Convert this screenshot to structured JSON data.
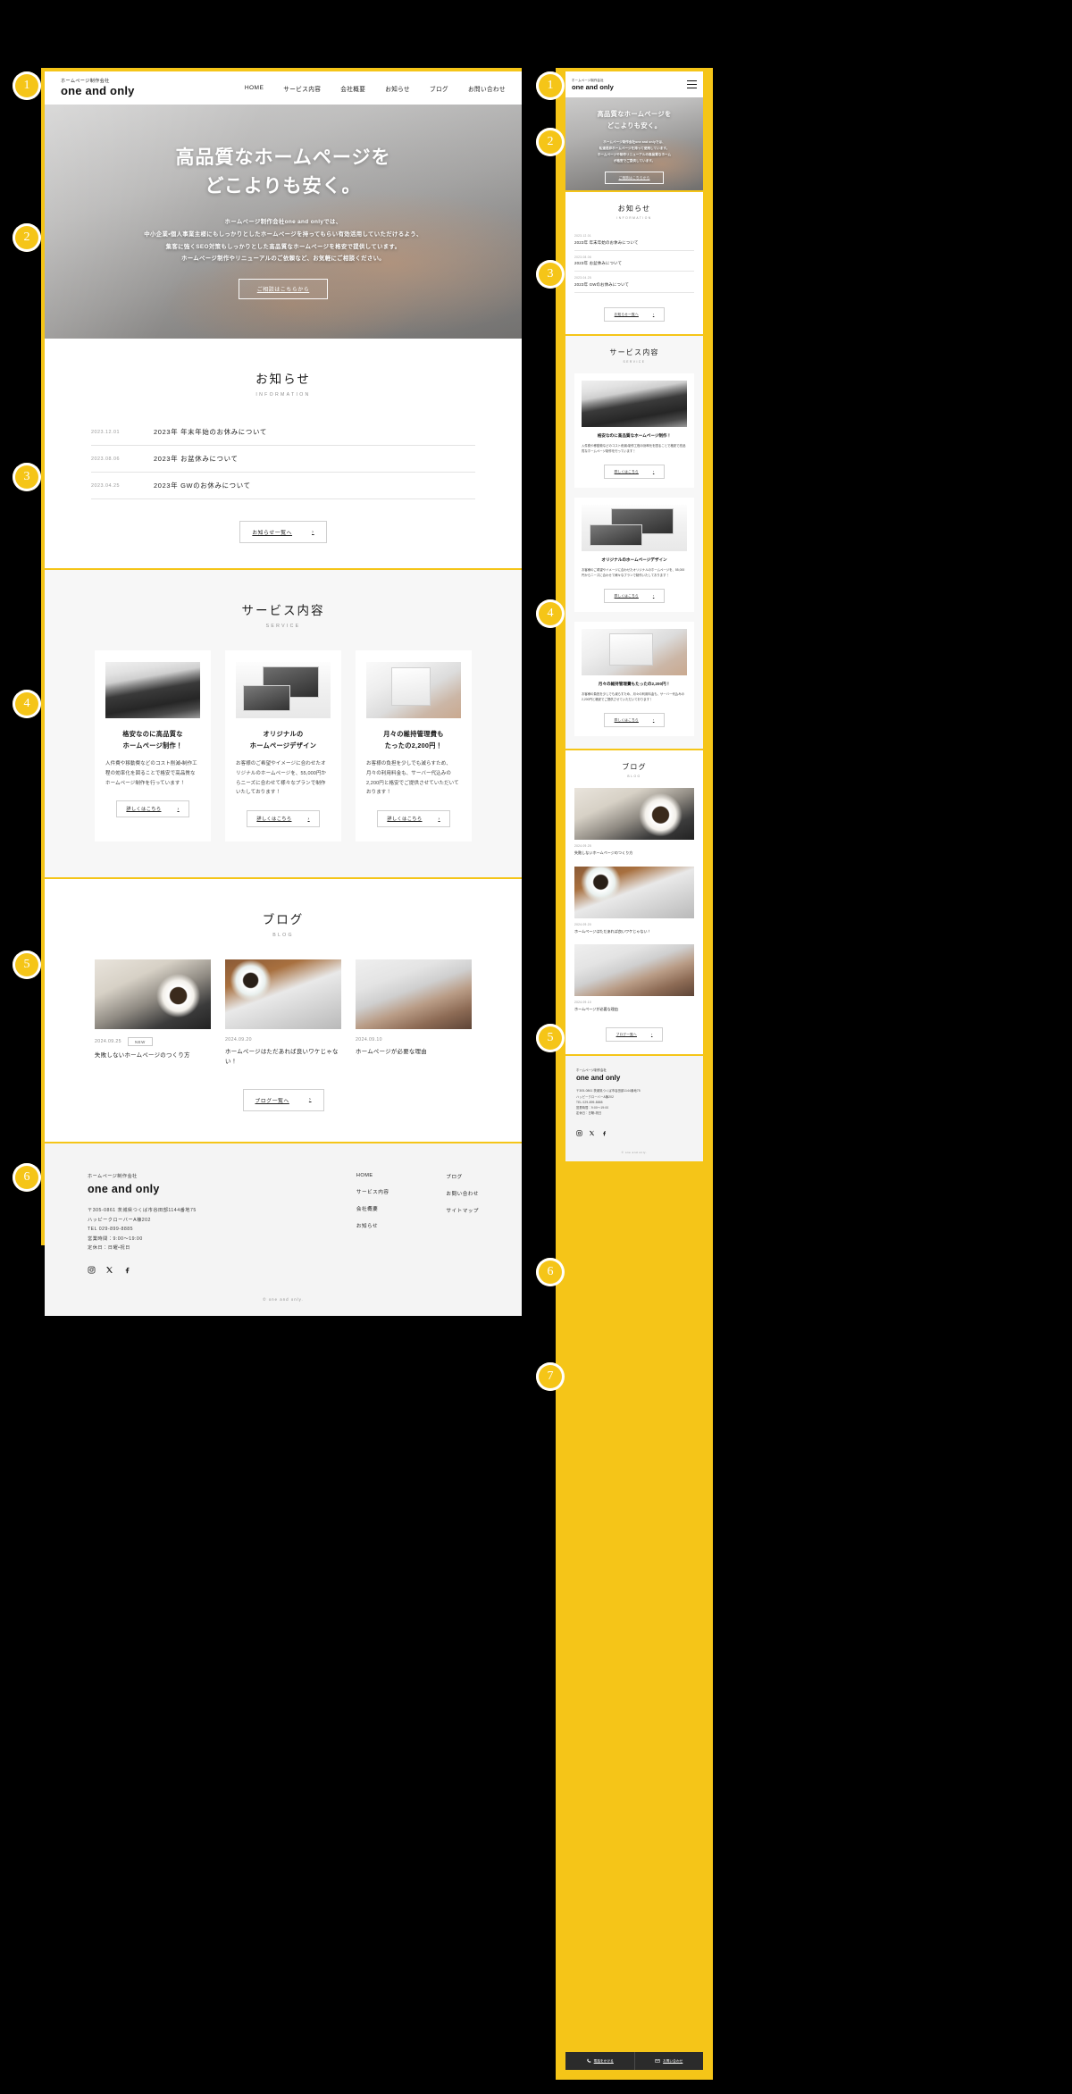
{
  "brand": {
    "sub": "ホームページ制作会社",
    "name": "one and only"
  },
  "nav": {
    "items": [
      "HOME",
      "サービス内容",
      "会社概要",
      "お知らせ",
      "ブログ",
      "お問い合わせ"
    ]
  },
  "hero": {
    "title_line1": "高品質なホームページを",
    "title_line2": "どこよりも安く。",
    "desc": [
      "ホームページ制作会社one and onlyでは、",
      "中小企業・個人事業主様にもしっかりとしたホームページを持ってもらい有効活用していただけるよう、",
      "集客に強くSEO対策もしっかりとした高品質なホームページを格安で提供しています。",
      "ホームページ制作やリニューアルのご依頼など、お気軽にご相談ください。"
    ],
    "mobile_desc": [
      "ホームページ制作会社one and onlyでは、",
      "私達是非ホームページを持って使用しています。",
      "ホームページや制作リニューアルの高品質なホーム",
      "が格安でご提供しています。"
    ],
    "cta": "ご相談はこちらから"
  },
  "news": {
    "heading_ja": "お知らせ",
    "heading_en": "INFORMATION",
    "items": [
      {
        "date": "2023.12.01",
        "title": "2023年 年末年始のお休みについて"
      },
      {
        "date": "2023.08.06",
        "title": "2023年 お盆休みについて"
      },
      {
        "date": "2023.04.25",
        "title": "2023年 GWのお休みについて"
      }
    ],
    "more": "お知らせ一覧へ"
  },
  "service": {
    "heading_ja": "サービス内容",
    "heading_en": "SERVICE",
    "cards": [
      {
        "image": "laptop-keyboard-photo",
        "title_line1": "格安なのに高品質な",
        "title_line2": "ホームページ制作！",
        "body": "人件費や移動費などのコスト削減・制作工程の効率化を図ることで格安で高品質なホームページ制作を行っています！",
        "button": "詳しくはこちら"
      },
      {
        "image": "responsive-devices-photo",
        "title_line1": "オリジナルの",
        "title_line2": "ホームページデザイン",
        "body": "お客様のご希望やイメージに合わせたオリジナルのホームページを、55,000円からニーズに合わせて様々なプランで制作いたしております！",
        "button": "詳しくはこちら"
      },
      {
        "image": "calculator-hand-photo",
        "title_line1": "月々の維持管理費も",
        "title_line2": "たったの2,200円！",
        "body": "お客様の負担を少しでも減らすため、月々の利用料金も、サーバー代込みの2,200円と格安でご提供させていただいております！",
        "button": "詳しくはこちら"
      }
    ]
  },
  "blog": {
    "heading_ja": "ブログ",
    "heading_en": "BLOG",
    "posts": [
      {
        "image": "laptop-coffee-photo",
        "date": "2024.09.25",
        "badge": "NEW",
        "title": "失敗しないホームページのつくり方"
      },
      {
        "image": "coffee-keyboard-photo",
        "date": "2024.09.20",
        "badge": "",
        "title": "ホームページはただあれば良いワケじゃない！"
      },
      {
        "image": "woman-laptop-photo",
        "date": "2024.09.10",
        "badge": "",
        "title": "ホームページが必要な理由"
      }
    ],
    "more": "ブログ一覧へ"
  },
  "footer": {
    "sub": "ホームページ制作会社",
    "name": "one and only",
    "address_lines": [
      "〒305-0861 茨城県つくば市谷田部1144番地75",
      "ハッピークローバーA棟202",
      "TEL 029-899-8885",
      "営業時間：9:00〜19:00",
      "定休日：日曜・祝日"
    ],
    "nav_col1": [
      "HOME",
      "サービス内容",
      "会社概要",
      "お知らせ"
    ],
    "nav_col2": [
      "ブログ",
      "お問い合わせ",
      "サイトマップ"
    ],
    "socials": [
      "instagram-icon",
      "x-twitter-icon",
      "facebook-icon"
    ],
    "copyright": "© one and only."
  },
  "mobile_bottom_bar": {
    "call": "電話をかける",
    "contact": "お問い合わせ",
    "call_icon": "phone-icon",
    "contact_icon": "mail-icon"
  },
  "callouts": {
    "desktop": [
      "1",
      "2",
      "3",
      "4",
      "5",
      "6"
    ],
    "mobile": [
      "1",
      "2",
      "3",
      "4",
      "5",
      "6",
      "7"
    ]
  },
  "colors": {
    "accent": "#F5C518",
    "text": "#1b1b1b",
    "muted": "#8d8d8d",
    "bg_light": "#f7f7f7",
    "footer_bg": "#f4f4f4",
    "bottom_bar": "#2b2b2b"
  }
}
